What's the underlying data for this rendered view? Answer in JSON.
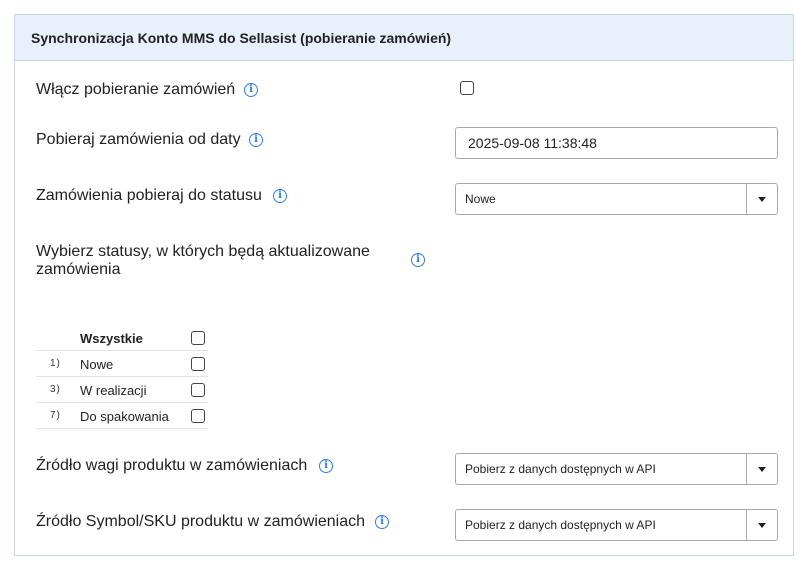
{
  "header": {
    "title": "Synchronizacja Konto MMS do Sellasist (pobieranie zamówień)"
  },
  "fields": {
    "enable_orders": {
      "label": "Włącz pobieranie zamówień",
      "checked": false
    },
    "date_from": {
      "label": "Pobieraj zamówienia od daty",
      "value": "2025-09-08 11:38:48"
    },
    "target_status": {
      "label": "Zamówienia pobieraj do statusu",
      "value": "Nowe"
    },
    "update_statuses": {
      "label": "Wybierz statusy, w których będą aktualizowane zamówienia"
    },
    "weight_source": {
      "label": "Źródło wagi produktu w zamówieniach",
      "value": "Pobierz z danych dostępnych w API"
    },
    "sku_source": {
      "label": "Źródło Symbol/SKU produktu w zamówieniach",
      "value": "Pobierz z danych dostępnych w API"
    }
  },
  "status_table": {
    "all_label": "Wszystkie",
    "rows": [
      {
        "num": "1)",
        "label": "Nowe",
        "checked": false
      },
      {
        "num": "3)",
        "label": "W realizacji",
        "checked": false
      },
      {
        "num": "7)",
        "label": "Do spakowania",
        "checked": false
      }
    ]
  },
  "icons": {
    "info": "info-icon",
    "dropdown": "caret-down-icon"
  },
  "colors": {
    "header_bg": "#e8f1fb",
    "info_blue": "#2f7de1",
    "border": "#c9d6e3"
  }
}
